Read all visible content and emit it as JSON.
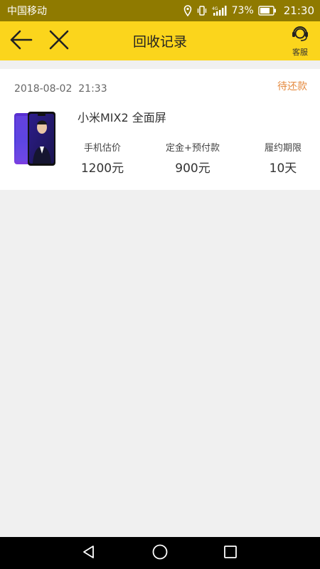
{
  "status_bar": {
    "carrier": "中国移动",
    "battery_percent": "73%",
    "time": "21:30"
  },
  "header": {
    "title": "回收记录",
    "service_label": "客服",
    "back_icon": "arrow-left-icon",
    "close_icon": "close-icon",
    "service_icon": "headset-icon",
    "bg_color": "#fbd51c"
  },
  "record": {
    "datetime": "2018-08-02  21:33",
    "status": "待还款",
    "status_color": "#e58a3f",
    "product_name": "小米MIX2 全面屏",
    "stats": [
      {
        "label": "手机估价",
        "value": "1200元"
      },
      {
        "label": "定金+预付款",
        "value": "900元"
      },
      {
        "label": "履约期限",
        "value": "10天"
      }
    ]
  },
  "nav": {
    "back_icon": "triangle-back-icon",
    "home_icon": "circle-home-icon",
    "recent_icon": "square-recent-icon"
  }
}
